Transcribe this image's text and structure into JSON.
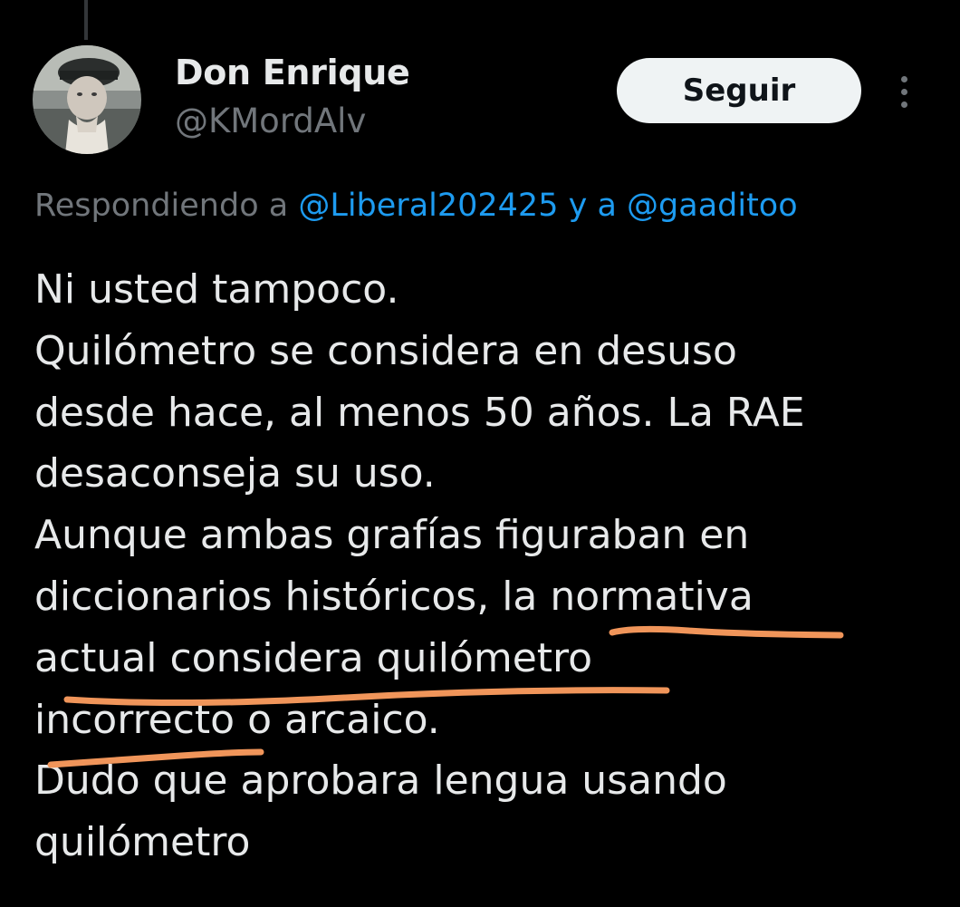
{
  "user": {
    "display_name": "Don Enrique",
    "handle": "@KMordAlv"
  },
  "actions": {
    "follow_label": "Seguir",
    "more_icon": "more-vertical-icon"
  },
  "reply_context": {
    "prefix": "Respondiendo a ",
    "mention_1": "@Liberal202425",
    "connector": " y a ",
    "mention_2": "@gaaditoo"
  },
  "tweet": {
    "lines": [
      "Ni usted tampoco.",
      "Quilómetro se considera en desuso",
      "desde hace, al menos 50 años. La RAE",
      "desaconseja su uso.",
      "Aunque ambas grafías figuraban en",
      "diccionarios históricos, la normativa",
      "actual considera quilómetro",
      "incorrecto o arcaico.",
      "Dudo que aprobara lengua usando",
      "quilómetro"
    ]
  },
  "colors": {
    "background": "#000000",
    "text_primary": "#e7e9ea",
    "text_secondary": "#71767b",
    "link": "#1d9bf0",
    "follow_bg": "#eff3f4",
    "annotation_orange": "#f0955a"
  }
}
